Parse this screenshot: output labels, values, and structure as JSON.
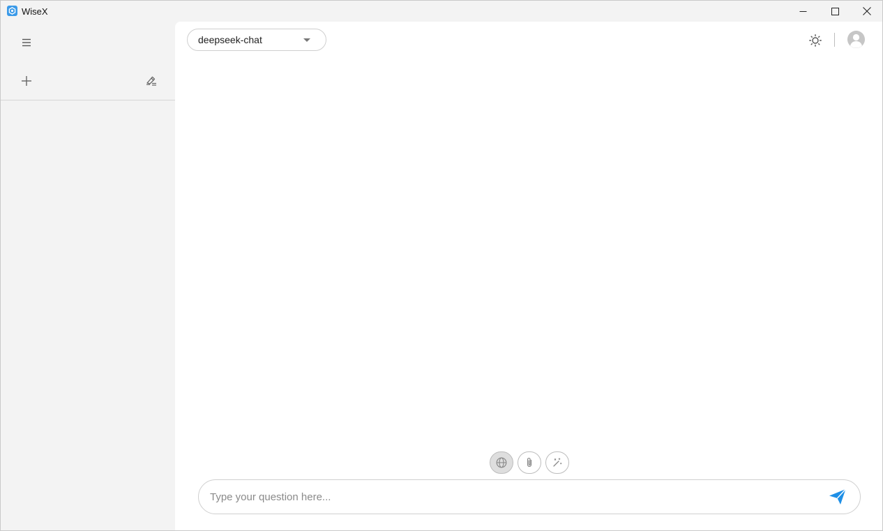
{
  "window": {
    "title": "WiseX"
  },
  "colors": {
    "accent": "#1e8fe6",
    "sidebar_bg": "#f3f3f3",
    "main_bg": "#ffffff",
    "app_icon": "#3b9ae8"
  },
  "icons": {
    "app": "wisex-logo-icon",
    "minimize": "minimize-icon",
    "maximize": "maximize-icon",
    "close": "close-icon",
    "menu": "hamburger-menu-icon",
    "new_chat": "plus-icon",
    "clear": "eraser-icon",
    "theme": "sun-icon",
    "avatar": "user-avatar-icon",
    "web_search": "globe-icon",
    "attach": "paperclip-icon",
    "magic": "magic-wand-icon",
    "send": "paper-plane-icon"
  },
  "header": {
    "model_selected": "deepseek-chat"
  },
  "input": {
    "value": "",
    "placeholder": "Type your question here..."
  }
}
